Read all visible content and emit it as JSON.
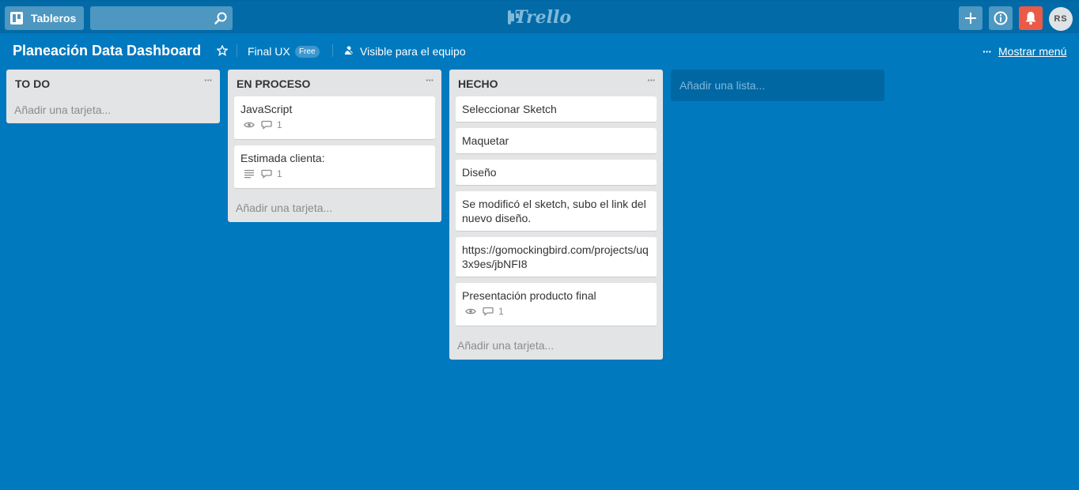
{
  "header": {
    "boards_label": "Tableros",
    "search_placeholder": "",
    "logo_text": "Trello",
    "avatar_initials": "RS"
  },
  "board": {
    "title": "Planeación Data Dashboard",
    "team": "Final UX",
    "team_badge": "Free",
    "visibility": "Visible para el equipo",
    "more": "···",
    "show_menu": "Mostrar menú"
  },
  "lists": [
    {
      "title": "TO DO",
      "menu": "···",
      "add_card": "Añadir una tarjeta...",
      "cards": []
    },
    {
      "title": "EN PROCESO",
      "menu": "···",
      "add_card": "Añadir una tarjeta...",
      "cards": [
        {
          "text": "JavaScript",
          "badges": {
            "watch": true,
            "comments": "1"
          }
        },
        {
          "text": "Estimada clienta:",
          "badges": {
            "description": true,
            "comments": "1"
          }
        }
      ]
    },
    {
      "title": "HECHO",
      "menu": "···",
      "add_card": "Añadir una tarjeta...",
      "cards": [
        {
          "text": "Seleccionar Sketch"
        },
        {
          "text": "Maquetar"
        },
        {
          "text": "Diseño"
        },
        {
          "text": "Se modificó el sketch, subo el link del nuevo diseño."
        },
        {
          "text": "https://gomockingbird.com/projects/uq3x9es/jbNFI8"
        },
        {
          "text": "Presentación producto final",
          "badges": {
            "watch": true,
            "comments": "1"
          }
        }
      ]
    }
  ],
  "add_list": "Añadir una lista...",
  "colors": {
    "board_bg": "#0079bf",
    "header_bg": "#026aa7",
    "notification": "#eb5a46",
    "list_bg": "#e2e4e6"
  }
}
